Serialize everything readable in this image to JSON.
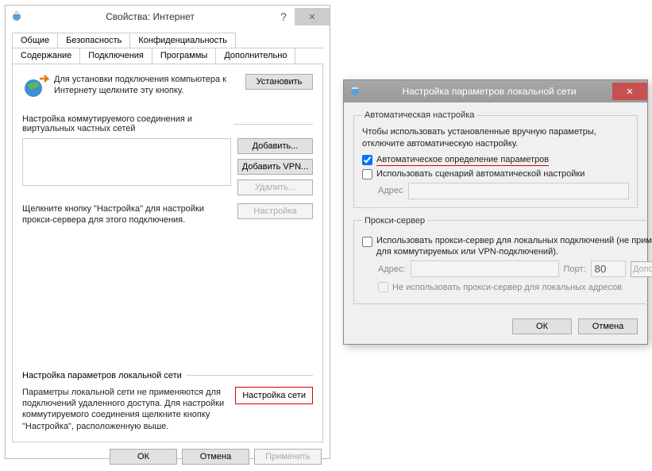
{
  "left": {
    "title": "Свойства: Интернет",
    "help": "?",
    "close": "✕",
    "tabs1": [
      "Общие",
      "Безопасность",
      "Конфиденциальность"
    ],
    "tabs2": [
      "Содержание",
      "Подключения",
      "Программы",
      "Дополнительно"
    ],
    "active_tab": "Подключения",
    "setup_text": "Для установки подключения компьютера к Интернету щелкните эту кнопку.",
    "btn_setup": "Установить",
    "section_dial": "Настройка коммутируемого соединения и виртуальных частных сетей",
    "btn_add": "Добавить...",
    "btn_add_vpn": "Добавить VPN...",
    "btn_remove": "Удалить...",
    "proxy_text": "Щелкните кнопку \"Настройка\" для настройки прокси-сервера для этого подключения.",
    "btn_settings": "Настройка",
    "lan_header": "Настройка параметров локальной сети",
    "lan_text": "Параметры локальной сети не применяются для подключений удаленного доступа. Для настройки коммутируемого соединения щелкните кнопку \"Настройка\", расположенную выше.",
    "btn_lan": "Настройка сети",
    "btn_ok": "ОК",
    "btn_cancel": "Отмена",
    "btn_apply": "Применить"
  },
  "right": {
    "title": "Настройка параметров локальной сети",
    "close": "✕",
    "group_auto": "Автоматическая настройка",
    "auto_text": "Чтобы использовать установленные вручную параметры, отключите автоматическую настройку.",
    "cb_autodetect": "Автоматическое определение параметров",
    "cb_usescript": "Использовать сценарий автоматической настройки",
    "lbl_address": "Адрес",
    "group_proxy": "Прокси-сервер",
    "cb_useproxy": "Использовать прокси-сервер для локальных подключений (не применяется для коммутируемых или VPN-подключений).",
    "lbl_address2": "Адрес:",
    "lbl_port": "Порт:",
    "port_value": "80",
    "btn_advanced": "Дополнительно",
    "cb_bypass": "Не использовать прокси-сервер для локальных адресов",
    "btn_ok": "ОК",
    "btn_cancel": "Отмена"
  }
}
